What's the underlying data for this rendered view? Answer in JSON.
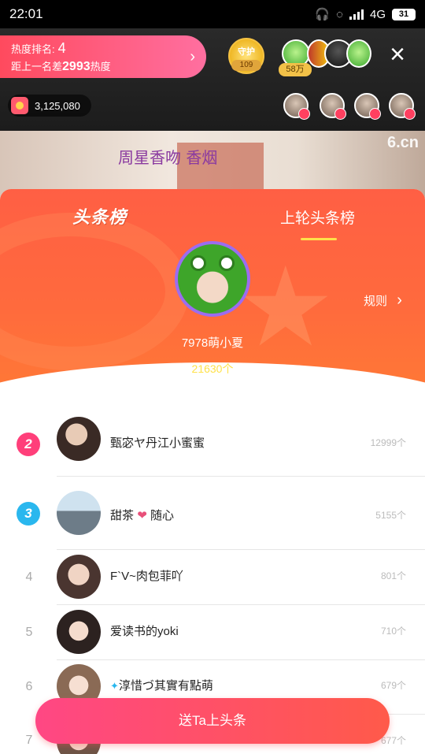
{
  "status_bar": {
    "time": "22:01",
    "network": "4G",
    "battery": "31"
  },
  "live_header": {
    "rank_label": "热度排名:",
    "rank_value": "4",
    "gap_prefix": "距上一名差",
    "gap_value": "2993",
    "gap_suffix": "热度",
    "guard_label": "守护",
    "guard_count": "109",
    "fans_badge": "58万",
    "coins": "3,125,080"
  },
  "video": {
    "caption": "周星香吻 香烟",
    "watermark": "6.cn"
  },
  "leaderboard": {
    "tab_current": "头条榜",
    "tab_previous": "上轮头条榜",
    "rules_label": "规则",
    "champion": {
      "name": "7978萌小夏",
      "count": "21630个"
    },
    "rows": [
      {
        "rank": "2",
        "name": "甄宓ヤ丹江小蜜蜜",
        "count": "12999个"
      },
      {
        "rank": "3",
        "name": "甜茶",
        "name_suffix": "随心",
        "count": "5155个"
      },
      {
        "rank": "4",
        "name": "F`V~肉包菲吖",
        "count": "801个"
      },
      {
        "rank": "5",
        "name": "爱读书的yoki",
        "count": "710个"
      },
      {
        "rank": "6",
        "name": "淳惜づ其實有點萌",
        "count": "679个"
      },
      {
        "rank": "7",
        "name": "",
        "count": "677个"
      }
    ]
  },
  "cta_label": "送Ta上头条",
  "colors": {
    "accent": "#ff5f44",
    "cta_start": "#ff4784",
    "highlight": "#ffe14a",
    "medal_2": "#ff3f7a",
    "medal_3": "#2ab7ee"
  }
}
